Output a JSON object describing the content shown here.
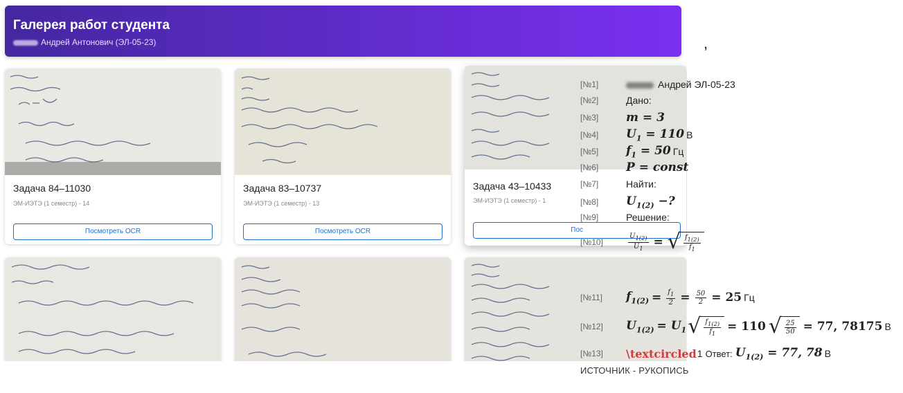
{
  "gallery": {
    "header": {
      "title": "Галерея работ студента",
      "subtitle": "Андрей Антонович (ЭЛ-05-23)"
    },
    "cards": [
      {
        "title": "Задача 84–11030",
        "meta": "ЭМ-ИЭТЭ (1 семестр) - 14",
        "button": "Посмотреть OCR"
      },
      {
        "title": "Задача 83–10737",
        "meta": "ЭМ-ИЭТЭ (1 семестр) - 13",
        "button": "Посмотреть OCR"
      },
      {
        "title": "Задача 43–10433",
        "meta": "ЭМ-ИЭТЭ (1 семестр) - 1",
        "button": "Пос"
      }
    ]
  },
  "caption": {
    "comma": ","
  },
  "ocr": {
    "lines": [
      {
        "num": "[№1]",
        "text": "Андрей ЭЛ-05-23"
      },
      {
        "num": "[№2]",
        "text": "Дано:"
      },
      {
        "num": "[№3]",
        "math": "m = 3"
      },
      {
        "num": "[№4]",
        "math": "U",
        "sub": "1",
        "rest": " = 110",
        "unit": "В"
      },
      {
        "num": "[№5]",
        "math": "f",
        "sub": "1",
        "rest": " = 50",
        "unit": "Гц"
      },
      {
        "num": "[№6]",
        "math": "P = const"
      },
      {
        "num": "[№7]",
        "text": "Найти:"
      },
      {
        "num": "[№8]",
        "math": "U",
        "sub": "1(2)",
        "rest": " −?"
      },
      {
        "num": "[№9]",
        "text": "Решение:"
      },
      {
        "num": "[№10]",
        "frac_n": "U",
        "frac_n_sub": "1(2)",
        "frac_d": "U",
        "frac_d_sub": "1",
        "eq": "=",
        "sqrt_n": "f",
        "sqrt_n_sub": "1(2)",
        "sqrt_d": "f",
        "sqrt_d_sub": "1"
      },
      {
        "num": "[№11]",
        "lhs": "f",
        "lhs_sub": "1(2)",
        "eq": "=",
        "f1_n": "f",
        "f1_n_sub": "1",
        "f1_d": "2",
        "eq2": "=",
        "f2_n": "50",
        "f2_d": "2",
        "rest": "= 25",
        "unit": "Гц"
      },
      {
        "num": "[№12]",
        "lhs": "U",
        "lhs_sub": "1(2)",
        "eq": "= U",
        "eq_sub": "1",
        "sqrt_n": "f",
        "sqrt_n_sub": "1(2)",
        "sqrt_d": "f",
        "sqrt_d_sub": "1",
        "mid": "= 110",
        "sqrt2_n": "25",
        "sqrt2_d": "50",
        "rest": "= 77, 78175",
        "unit": "В"
      },
      {
        "num": "[№13]",
        "cmd": "\\textcircled",
        "cmd_arg": "1",
        "answer_label": "Ответ:",
        "lhs": "U",
        "lhs_sub": "1(2)",
        "rest": " = 77, 78",
        "unit": "В"
      }
    ],
    "source": "ИСТОЧНИК - РУКОПИСЬ"
  }
}
